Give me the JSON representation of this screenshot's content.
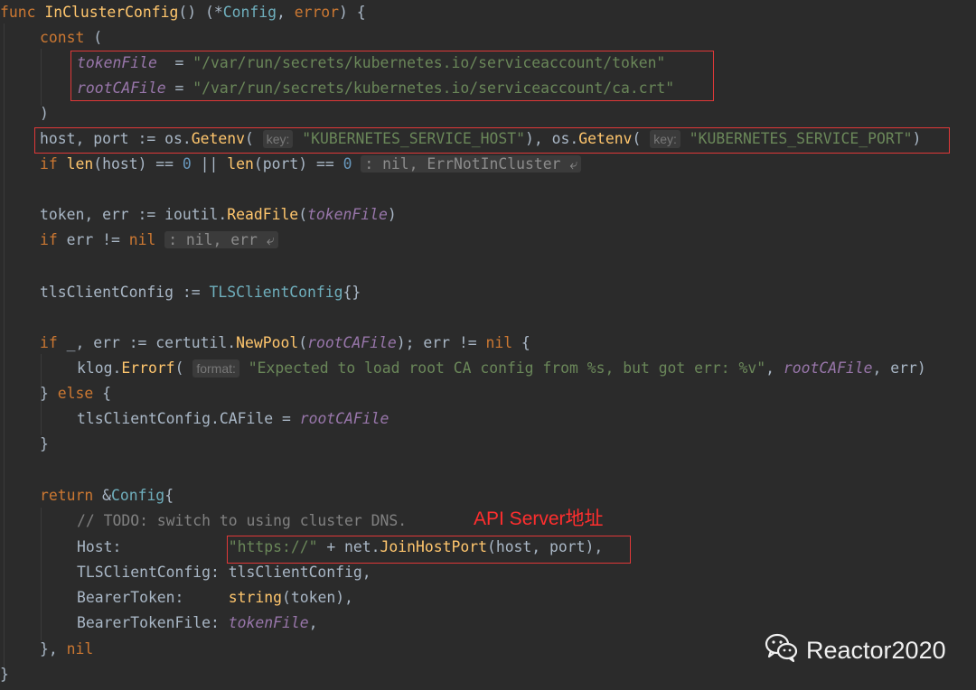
{
  "code": {
    "func_kw": "func",
    "func_name": "InClusterConfig",
    "func_sig_a": "() (*",
    "func_ret_type": "Config",
    "func_sig_b": ", ",
    "func_err_type": "error",
    "func_sig_c": ") {",
    "const_kw": "const",
    "const_open": " (",
    "token_var": "tokenFile",
    "token_eq": "  = ",
    "token_path": "\"/var/run/secrets/kubernetes.io/serviceaccount/token\"",
    "ca_var": "rootCAFile",
    "ca_eq": " = ",
    "ca_path": "\"/var/run/secrets/kubernetes.io/serviceaccount/ca.crt\"",
    "const_close": ")",
    "host_assign": "host, port := os.",
    "getenv_fn": "Getenv",
    "paren_open": "(",
    "key_hint": "key:",
    "host_env": "\"KUBERNETES_SERVICE_HOST\"",
    "comma_os": "), os.",
    "port_env": "\"KUBERNETES_SERVICE_PORT\"",
    "paren_close": ")",
    "if_kw": "if",
    "len_fn": "len",
    "len_host_a": "(host) == ",
    "zero": "0",
    "or_op": " || ",
    "len_port_a": "(port) == ",
    "fold_not_in_cluster": ": nil, ErrNotInCluster ⤶",
    "token_assign": "token, err := ioutil.",
    "readfile_fn": "ReadFile",
    "if_err_mid": " err != ",
    "nil_kw": "nil",
    "fold_nil_err": ": nil, err ⤶",
    "tls_assign": "tlsClientConfig := ",
    "tls_type": "TLSClientConfig",
    "braces": "{}",
    "if_pool_a": " _, err := certutil.",
    "newpool_fn": "NewPool",
    "pool_semi": "); err != ",
    "brace_open": " {",
    "klog_pre": "klog.",
    "errorf_fn": "Errorf",
    "format_hint": "format:",
    "err_msg": "\"Expected to load root CA config from %s, but got err: %v\"",
    "comma_space": ", ",
    "err_close": ", err)",
    "else_open": "} ",
    "else_kw": "else",
    "cafile_assign": "tlsClientConfig.CAFile = ",
    "brace_close": "}",
    "return_kw": "return",
    "return_tail": " &",
    "config_type": "Config",
    "open_brace": "{",
    "todo_comment": "// TODO: switch to using cluster DNS.",
    "host_field": "Host:            ",
    "https_str": "\"https://\"",
    "plus_net": " + net.",
    "joinhostport_fn": "JoinHostPort",
    "host_port_args": "(host, port),",
    "tls_field": "TLSClientConfig: tlsClientConfig,",
    "bearer_field": "BearerToken:     ",
    "string_fn": "string",
    "token_arg": "(token),",
    "bearer_file_field": "BearerTokenFile: ",
    "comma_end": ",",
    "close_nil_a": "}, ",
    "final_brace": "}"
  },
  "annotation": "API Server地址",
  "watermark": "Reactor2020",
  "watermark_icon": "wechat-icon",
  "colors": {
    "background": "#2b2b2b",
    "keyword": "#cc7832",
    "function": "#ffc66d",
    "string": "#6a8759",
    "highlight_box": "#e03838"
  }
}
